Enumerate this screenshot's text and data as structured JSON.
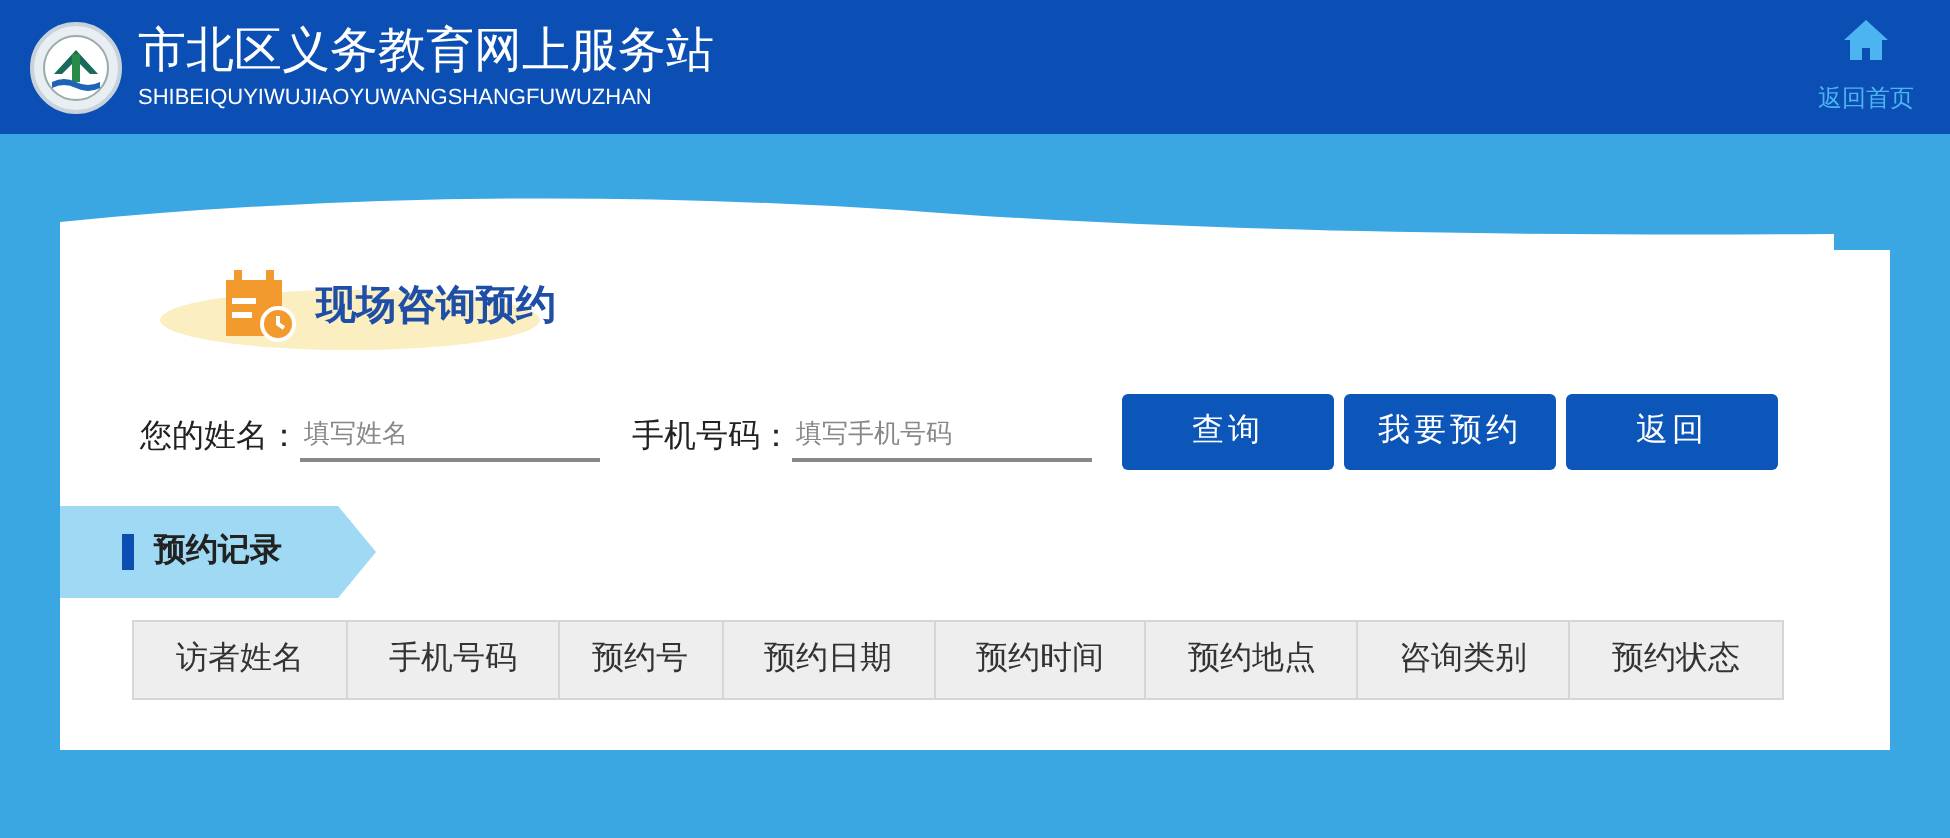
{
  "header": {
    "title": "市北区义务教育网上服务站",
    "subtitle": "SHIBEIQUYIWUJIAOYUWANGSHANGFUWUZHAN",
    "home_link": "返回首页"
  },
  "section_title": "现场咨询预约",
  "form": {
    "fields": [
      {
        "label": "您的姓名：",
        "placeholder": "填写姓名"
      },
      {
        "label": "手机号码：",
        "placeholder": "填写手机号码"
      }
    ],
    "buttons": [
      "查询",
      "我要预约",
      "返回"
    ]
  },
  "records": {
    "tab": "预约记录",
    "table": {
      "columns": [
        "访者姓名",
        "手机号码",
        "预约号",
        "预约日期",
        "预约时间",
        "预约地点",
        "咨询类别",
        "预约状态"
      ]
    }
  }
}
